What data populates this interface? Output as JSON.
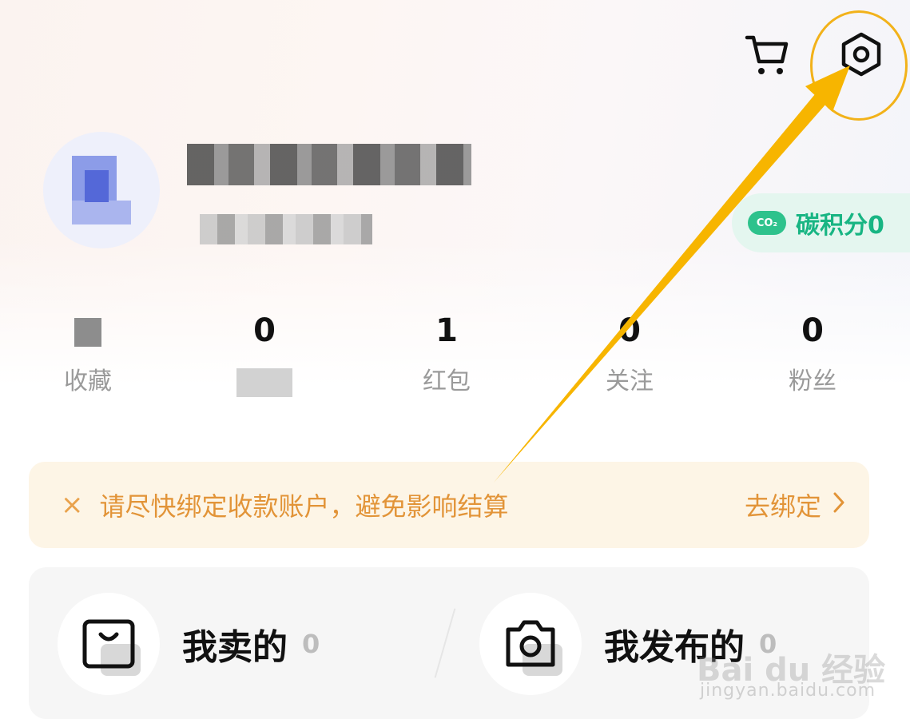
{
  "header": {
    "cart_icon": "shopping-cart-icon",
    "settings_icon": "settings-hexagon-icon"
  },
  "profile": {
    "carbon_badge_text": "CO₂",
    "carbon_points_label": "碳积分0"
  },
  "stats": [
    {
      "value": "",
      "label": "收藏"
    },
    {
      "value": "0",
      "label": ""
    },
    {
      "value": "1",
      "label": "红包"
    },
    {
      "value": "0",
      "label": "关注"
    },
    {
      "value": "0",
      "label": "粉丝"
    }
  ],
  "banner": {
    "close_glyph": "×",
    "message": "请尽快绑定收款账户，避免影响结算",
    "action_label": "去绑定",
    "accent_color": "#e29438"
  },
  "cards": {
    "sold": {
      "title": "我卖的",
      "count": "0"
    },
    "published": {
      "title": "我发布的",
      "count": "0"
    }
  },
  "annotation": {
    "highlight_color": "#f2b21a"
  },
  "watermark": {
    "main": "Bai du 经验",
    "sub": "jingyan.baidu.com"
  }
}
